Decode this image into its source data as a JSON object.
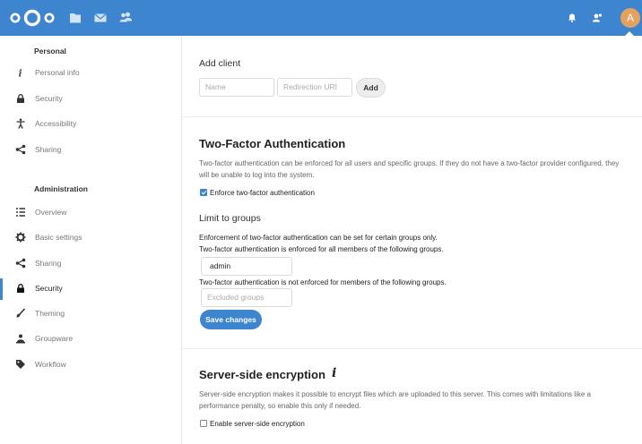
{
  "header": {
    "app_icons": [
      "nextcloud-logo",
      "files-icon",
      "mail-icon",
      "contacts-icon"
    ],
    "right_icons": [
      "notifications-icon",
      "contacts-menu-icon"
    ],
    "avatar_letter": "A",
    "bar_color": "#3e85cf",
    "avatar_color": "#e5a25e"
  },
  "sidebar": {
    "personal_heading": "Personal",
    "personal_items": [
      {
        "label": "Personal info",
        "icon": "info-icon"
      },
      {
        "label": "Security",
        "icon": "lock-icon"
      },
      {
        "label": "Accessibility",
        "icon": "accessibility-icon"
      },
      {
        "label": "Sharing",
        "icon": "share-icon"
      }
    ],
    "admin_heading": "Administration",
    "admin_items": [
      {
        "label": "Overview",
        "icon": "list-icon"
      },
      {
        "label": "Basic settings",
        "icon": "gear-icon"
      },
      {
        "label": "Sharing",
        "icon": "share-icon"
      },
      {
        "label": "Security",
        "icon": "lock-icon",
        "active": true
      },
      {
        "label": "Theming",
        "icon": "brush-icon"
      },
      {
        "label": "Groupware",
        "icon": "groupware-icon"
      },
      {
        "label": "Workflow",
        "icon": "tag-icon"
      }
    ]
  },
  "add_client": {
    "heading": "Add client",
    "name_placeholder": "Name",
    "uri_placeholder": "Redirection URI",
    "add_label": "Add"
  },
  "two_factor": {
    "heading": "Two-Factor Authentication",
    "description_line1": "Two-factor authentication can be enforced for all users and specific groups. If they do not have a two-factor provider configured, they",
    "description_line2": "will be unable to log into the system.",
    "enforce_label": "Enforce two-factor authentication",
    "enforce_checked": true,
    "limit_heading": "Limit to groups",
    "limit_text1": "Enforcement of two-factor authentication can be set for certain groups only.",
    "limit_text2": "Two-factor authentication is enforced for all members of the following groups.",
    "enforced_groups_value": "admin",
    "excluded_text": "Two-factor authentication is not enforced for members of the following groups.",
    "excluded_placeholder": "Excluded groups",
    "save_label": "Save changes"
  },
  "encryption": {
    "heading": "Server-side encryption",
    "description_line1": "Server-side encryption makes it possible to encrypt files which are uploaded to this server. This comes with limitations like a",
    "description_line2": "performance penalty, so enable this only if needed.",
    "enable_label": "Enable server-side encryption",
    "enable_checked": false
  }
}
